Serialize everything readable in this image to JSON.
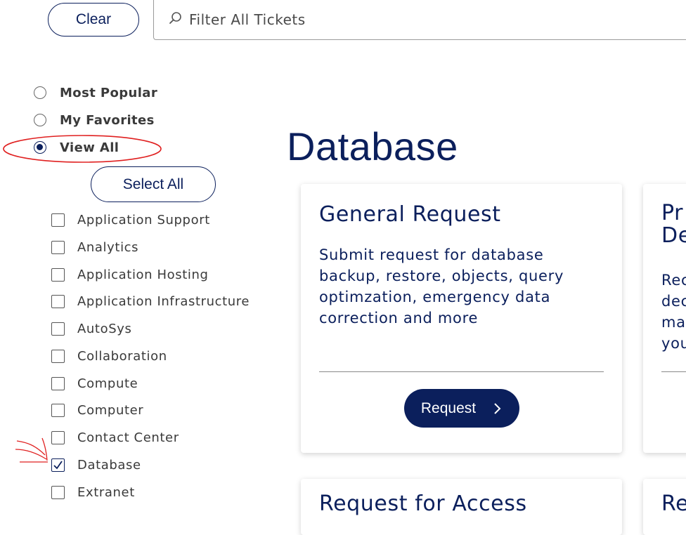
{
  "toolbar": {
    "clear_label": "Clear",
    "search_placeholder": "Filter All Tickets",
    "search_icon": "search-icon"
  },
  "view_filter": {
    "options": [
      {
        "label": "Most Popular",
        "checked": false
      },
      {
        "label": "My Favorites",
        "checked": false
      },
      {
        "label": "View All",
        "checked": true
      }
    ]
  },
  "categories": {
    "select_all_label": "Select All",
    "items": [
      {
        "label": "Application Support",
        "checked": false
      },
      {
        "label": "Analytics",
        "checked": false
      },
      {
        "label": "Application Hosting",
        "checked": false
      },
      {
        "label": "Application Infrastructure",
        "checked": false
      },
      {
        "label": "AutoSys",
        "checked": false
      },
      {
        "label": "Collaboration",
        "checked": false
      },
      {
        "label": "Compute",
        "checked": false
      },
      {
        "label": "Computer",
        "checked": false
      },
      {
        "label": "Contact Center",
        "checked": false
      },
      {
        "label": "Database",
        "checked": true
      },
      {
        "label": "Extranet",
        "checked": false
      }
    ]
  },
  "main": {
    "title": "Database",
    "cards": [
      {
        "title": "General Request",
        "description": "Submit request for database backup, restore, objects, query optimzation, emergency data correction and more",
        "button_label": "Request"
      },
      {
        "title_line1": "Pr",
        "title_line2": "De",
        "desc_lines": [
          "Rec",
          "dec",
          "ma",
          "you"
        ]
      },
      {
        "title": "Request for Access"
      },
      {
        "title": "Re"
      }
    ]
  },
  "colors": {
    "brand_navy": "#0b1f5c",
    "annotation_red": "#e02020"
  }
}
